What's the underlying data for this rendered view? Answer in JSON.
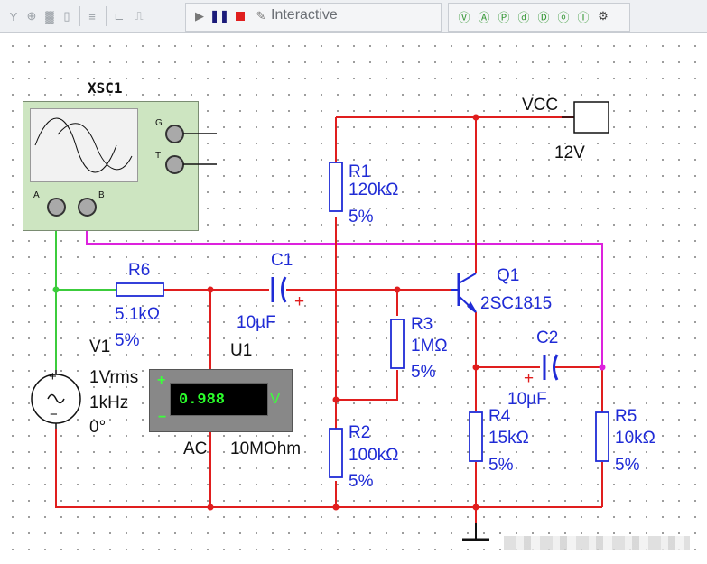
{
  "toolbar": {
    "interactive_label": "Interactive",
    "icons": [
      "probe-icon",
      "voltage-probe-icon",
      "current-probe-icon",
      "reference-icon",
      "bus-icon",
      "hierarchy-icon",
      "ladder-icon",
      "run-icon",
      "pause-icon",
      "stop-icon",
      "pen-icon",
      "probe-a-icon",
      "probe-b-icon",
      "probe-c-icon",
      "probe-d-icon",
      "probe-e-icon",
      "probe-f-icon",
      "probe-g-icon",
      "gear-icon"
    ]
  },
  "schematic": {
    "oscilloscope": {
      "name": "XSC1",
      "terminal_g": "G",
      "terminal_t": "T",
      "terminal_a": "A",
      "terminal_b": "B"
    },
    "vcc": {
      "name": "VCC",
      "value": "12V"
    },
    "r1": {
      "name": "R1",
      "value": "120kΩ",
      "tolerance": "5%"
    },
    "r2": {
      "name": "R2",
      "value": "100kΩ",
      "tolerance": "5%"
    },
    "r3": {
      "name": "R3",
      "value": "1MΩ",
      "tolerance": "5%"
    },
    "r4": {
      "name": "R4",
      "value": "15kΩ",
      "tolerance": "5%"
    },
    "r5": {
      "name": "R5",
      "value": "10kΩ",
      "tolerance": "5%"
    },
    "r6": {
      "name": "R6",
      "value": "5.1kΩ",
      "tolerance": "5%"
    },
    "c1": {
      "name": "C1",
      "value": "10µF",
      "polarity": "+"
    },
    "c2": {
      "name": "C2",
      "value": "10µF",
      "polarity": "+"
    },
    "q1": {
      "name": "Q1",
      "model": "2SC1815"
    },
    "v1": {
      "name": "V1",
      "amplitude": "1Vrms",
      "frequency": "1kHz",
      "phase": "0°",
      "plus": "+",
      "minus": "−"
    },
    "u1": {
      "name": "U1",
      "reading": "0.988",
      "unit": "V",
      "mode": "AC",
      "impedance": "10MOhm",
      "plus": "+",
      "minus": "−"
    }
  },
  "colors": {
    "wire_red": "#e01e1e",
    "wire_green": "#3ccc3c",
    "wire_magenta": "#dd22dd",
    "component_blue": "#1f2bd6",
    "scope_body": "#cde5c1",
    "meter_display_text": "#2bff2b"
  }
}
